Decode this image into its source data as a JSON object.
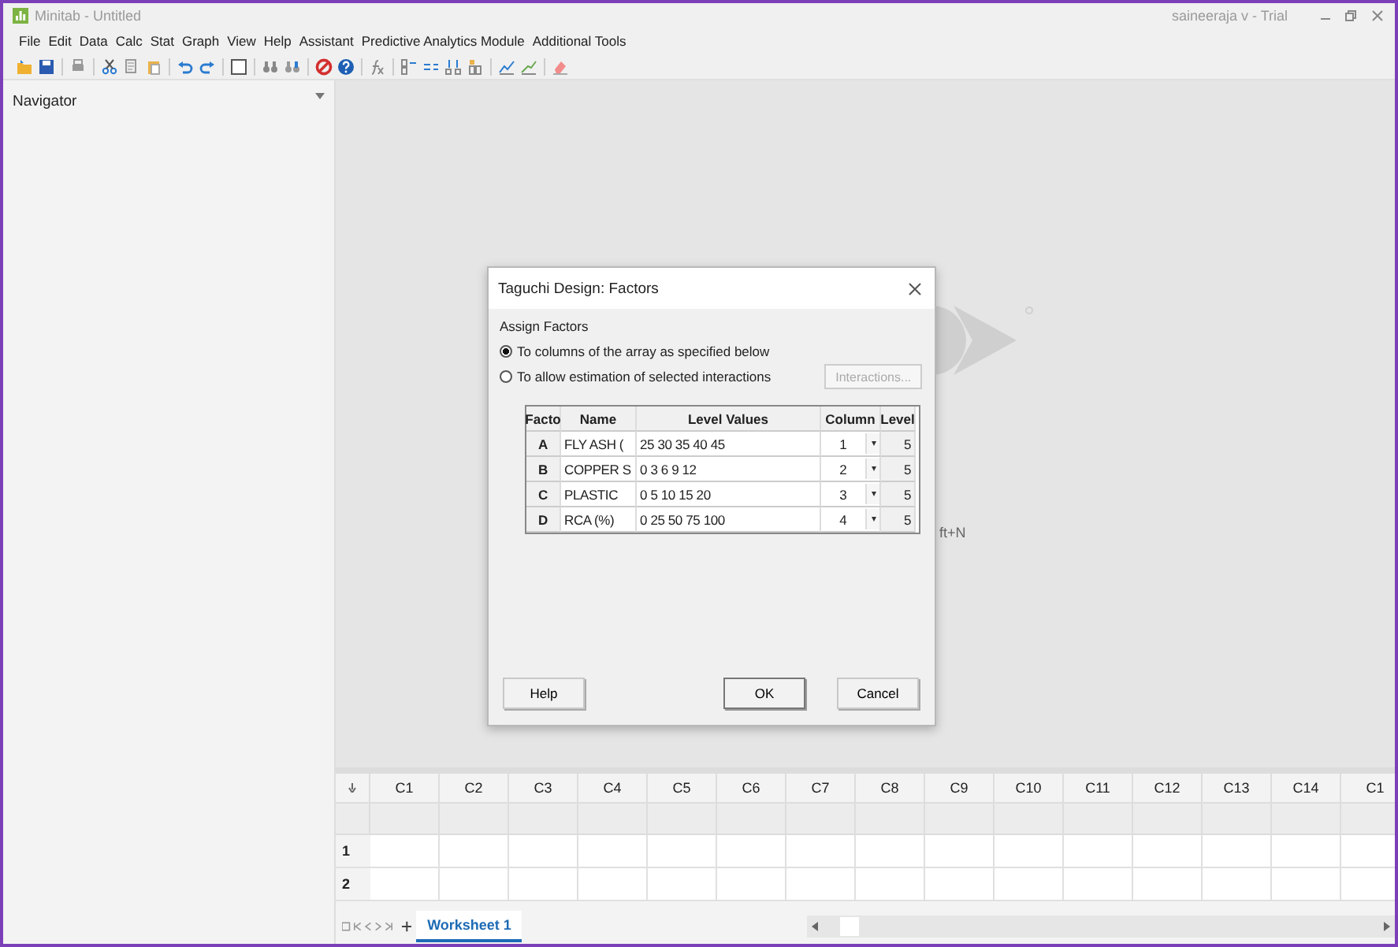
{
  "window": {
    "title": "Minitab - Untitled",
    "user_label": "saineeraja v - Trial"
  },
  "menu": [
    "File",
    "Edit",
    "Data",
    "Calc",
    "Stat",
    "Graph",
    "View",
    "Help",
    "Assistant",
    "Predictive Analytics Module",
    "Additional Tools"
  ],
  "navigator": {
    "title": "Navigator"
  },
  "background": {
    "shortcut_hint": "ft+N"
  },
  "dialog": {
    "title": "Taguchi Design: Factors",
    "group_label": "Assign Factors",
    "options": [
      {
        "label": "To columns of the array as specified below",
        "selected": true
      },
      {
        "label": "To allow estimation of selected interactions",
        "selected": false
      }
    ],
    "interactions_button": {
      "label": "Interactions...",
      "disabled": true
    },
    "table": {
      "columns": [
        "Facto",
        "Name",
        "Level Values",
        "Column",
        "Level"
      ],
      "rows": [
        {
          "factor": "A",
          "name": "FLY ASH (",
          "level_values": "25 30 35 40 45",
          "column": "1",
          "level": "5"
        },
        {
          "factor": "B",
          "name": "COPPER S",
          "level_values": "0 3 6 9 12",
          "column": "2",
          "level": "5"
        },
        {
          "factor": "C",
          "name": "PLASTIC",
          "level_values": "0 5 10 15 20",
          "column": "3",
          "level": "5"
        },
        {
          "factor": "D",
          "name": "RCA (%)",
          "level_values": "0 25 50 75 100",
          "column": "4",
          "level": "5"
        }
      ]
    },
    "buttons": [
      {
        "label": "Help",
        "kind": "plain"
      },
      {
        "label": "OK",
        "kind": "default"
      },
      {
        "label": "Cancel",
        "kind": "plain"
      }
    ]
  },
  "worksheet": {
    "columns": [
      "C1",
      "C2",
      "C3",
      "C4",
      "C5",
      "C6",
      "C7",
      "C8",
      "C9",
      "C10",
      "C11",
      "C12",
      "C13",
      "C14",
      "C1"
    ],
    "row_numbers": [
      "1",
      "2"
    ],
    "tabs": [
      {
        "label": "Worksheet 1",
        "selected": true
      }
    ]
  }
}
